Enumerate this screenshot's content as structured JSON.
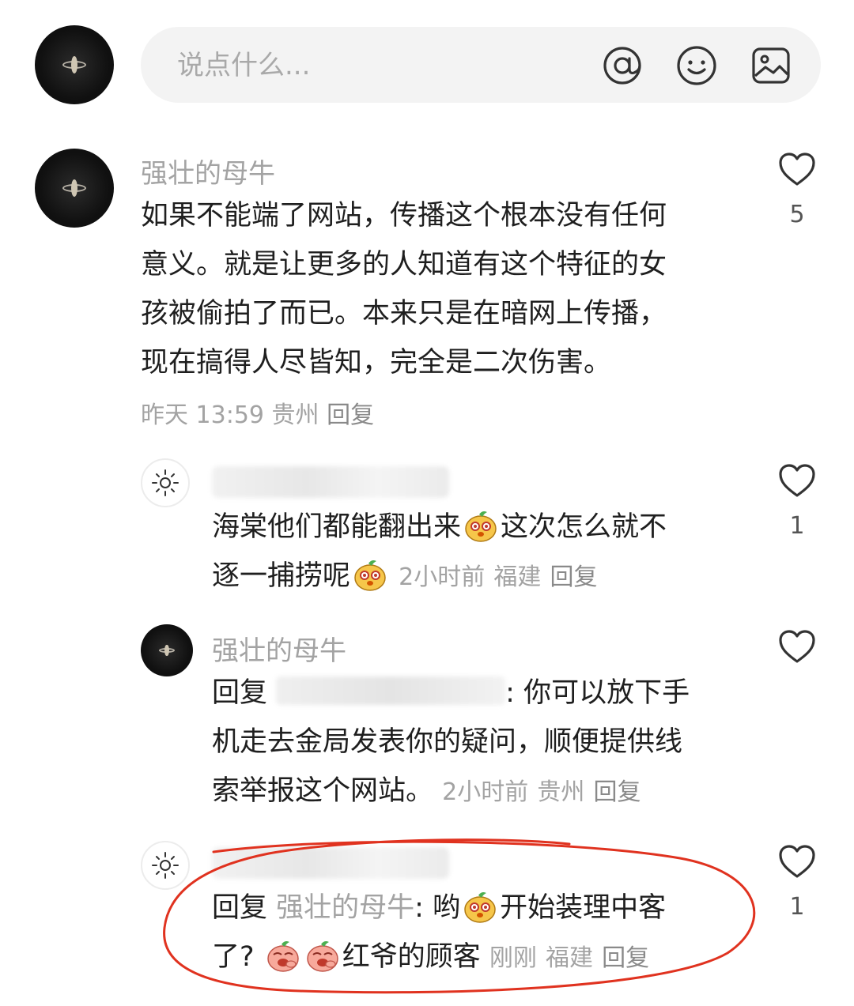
{
  "composer": {
    "placeholder": "说点什么...",
    "icons": [
      "at-icon",
      "emoji-icon",
      "image-icon"
    ]
  },
  "comments": [
    {
      "username": "强壮的母牛",
      "text": "如果不能端了网站，传播这个根本没有任何意义。就是让更多的人知道有这个特征的女孩被偷拍了而已。本来只是在暗网上传播，现在搞得人尽皆知，完全是二次伤害。",
      "lines": [
        "如果不能端了网站，传播这个根本没有任何",
        "意义。就是让更多的人知道有这个特征的女",
        "孩被偷拍了而已。本来只是在暗网上传播，",
        "现在搞得人尽皆知，完全是二次伤害。"
      ],
      "time": "昨天 13:59",
      "location": "贵州",
      "reply_label": "回复",
      "likes": "5",
      "replies": [
        {
          "username_blurred": true,
          "line1": "海棠他们都能翻出来",
          "line1_after": "这次怎么就不",
          "line2": "逐一捕捞呢",
          "time": "2小时前",
          "location": "福建",
          "reply_label": "回复",
          "likes": "1"
        },
        {
          "username": "强壮的母牛",
          "reply_prefix": "回复",
          "colon_text": ": 你可以放下手",
          "line2": "机走去金局发表你的疑问，顺便提供线",
          "line3": "索举报这个网站。",
          "time": "2小时前",
          "location": "贵州",
          "reply_label": "回复",
          "likes": ""
        },
        {
          "username_blurred": true,
          "reply_prefix": "回复",
          "reply_to": "强壮的母牛",
          "colon_text": ": 哟",
          "line1_after": "开始装理中客",
          "line2_start": "了?",
          "line2_after": "红爷的顾客",
          "time": "刚刚",
          "location": "福建",
          "reply_label": "回复",
          "likes": "1"
        }
      ]
    }
  ],
  "colors": {
    "secondary_text": "#a3a3a3",
    "annotation": "#e0321f"
  }
}
